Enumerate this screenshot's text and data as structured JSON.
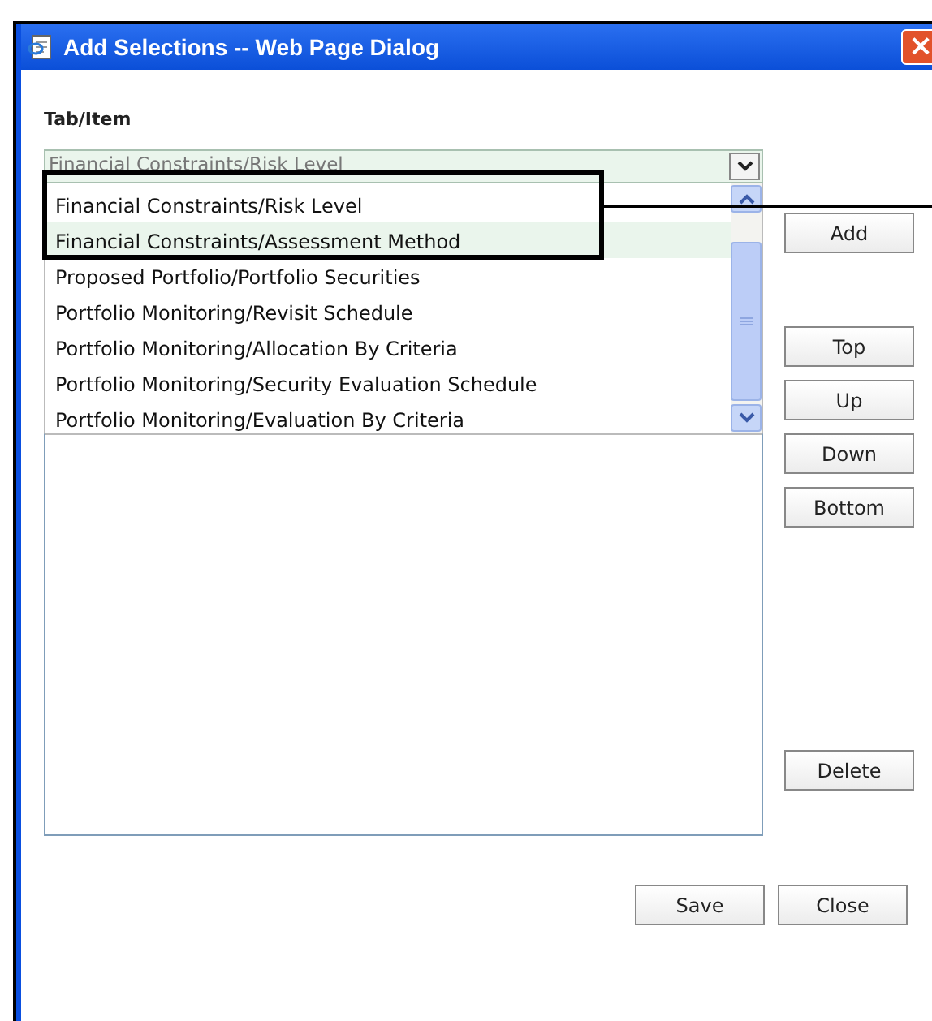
{
  "window": {
    "title": "Add Selections -- Web Page Dialog",
    "close": "×"
  },
  "field_label": "Tab/Item",
  "dropdown": {
    "value": "Financial Constraints/Risk Level"
  },
  "dropdown_list": {
    "items": [
      {
        "label": "Financial Constraints/Risk Level",
        "selected": false
      },
      {
        "label": "Financial Constraints/Assessment Method",
        "selected": true
      },
      {
        "label": "Proposed Portfolio/Portfolio Securities",
        "selected": false
      },
      {
        "label": "Portfolio Monitoring/Revisit Schedule",
        "selected": false
      },
      {
        "label": "Portfolio Monitoring/Allocation By Criteria",
        "selected": false
      },
      {
        "label": "Portfolio Monitoring/Security Evaluation Schedule",
        "selected": false
      },
      {
        "label": "Portfolio Monitoring/Evaluation By Criteria",
        "selected": false
      }
    ]
  },
  "side_buttons": [
    {
      "label": "Add",
      "kind": "add"
    },
    {
      "label": "Top",
      "kind": "move"
    },
    {
      "label": "Up",
      "kind": "move"
    },
    {
      "label": "Down",
      "kind": "move"
    },
    {
      "label": "Bottom",
      "kind": "move"
    },
    {
      "label": "Delete",
      "kind": "delete"
    }
  ],
  "footer_buttons": [
    "Save",
    "Close"
  ]
}
